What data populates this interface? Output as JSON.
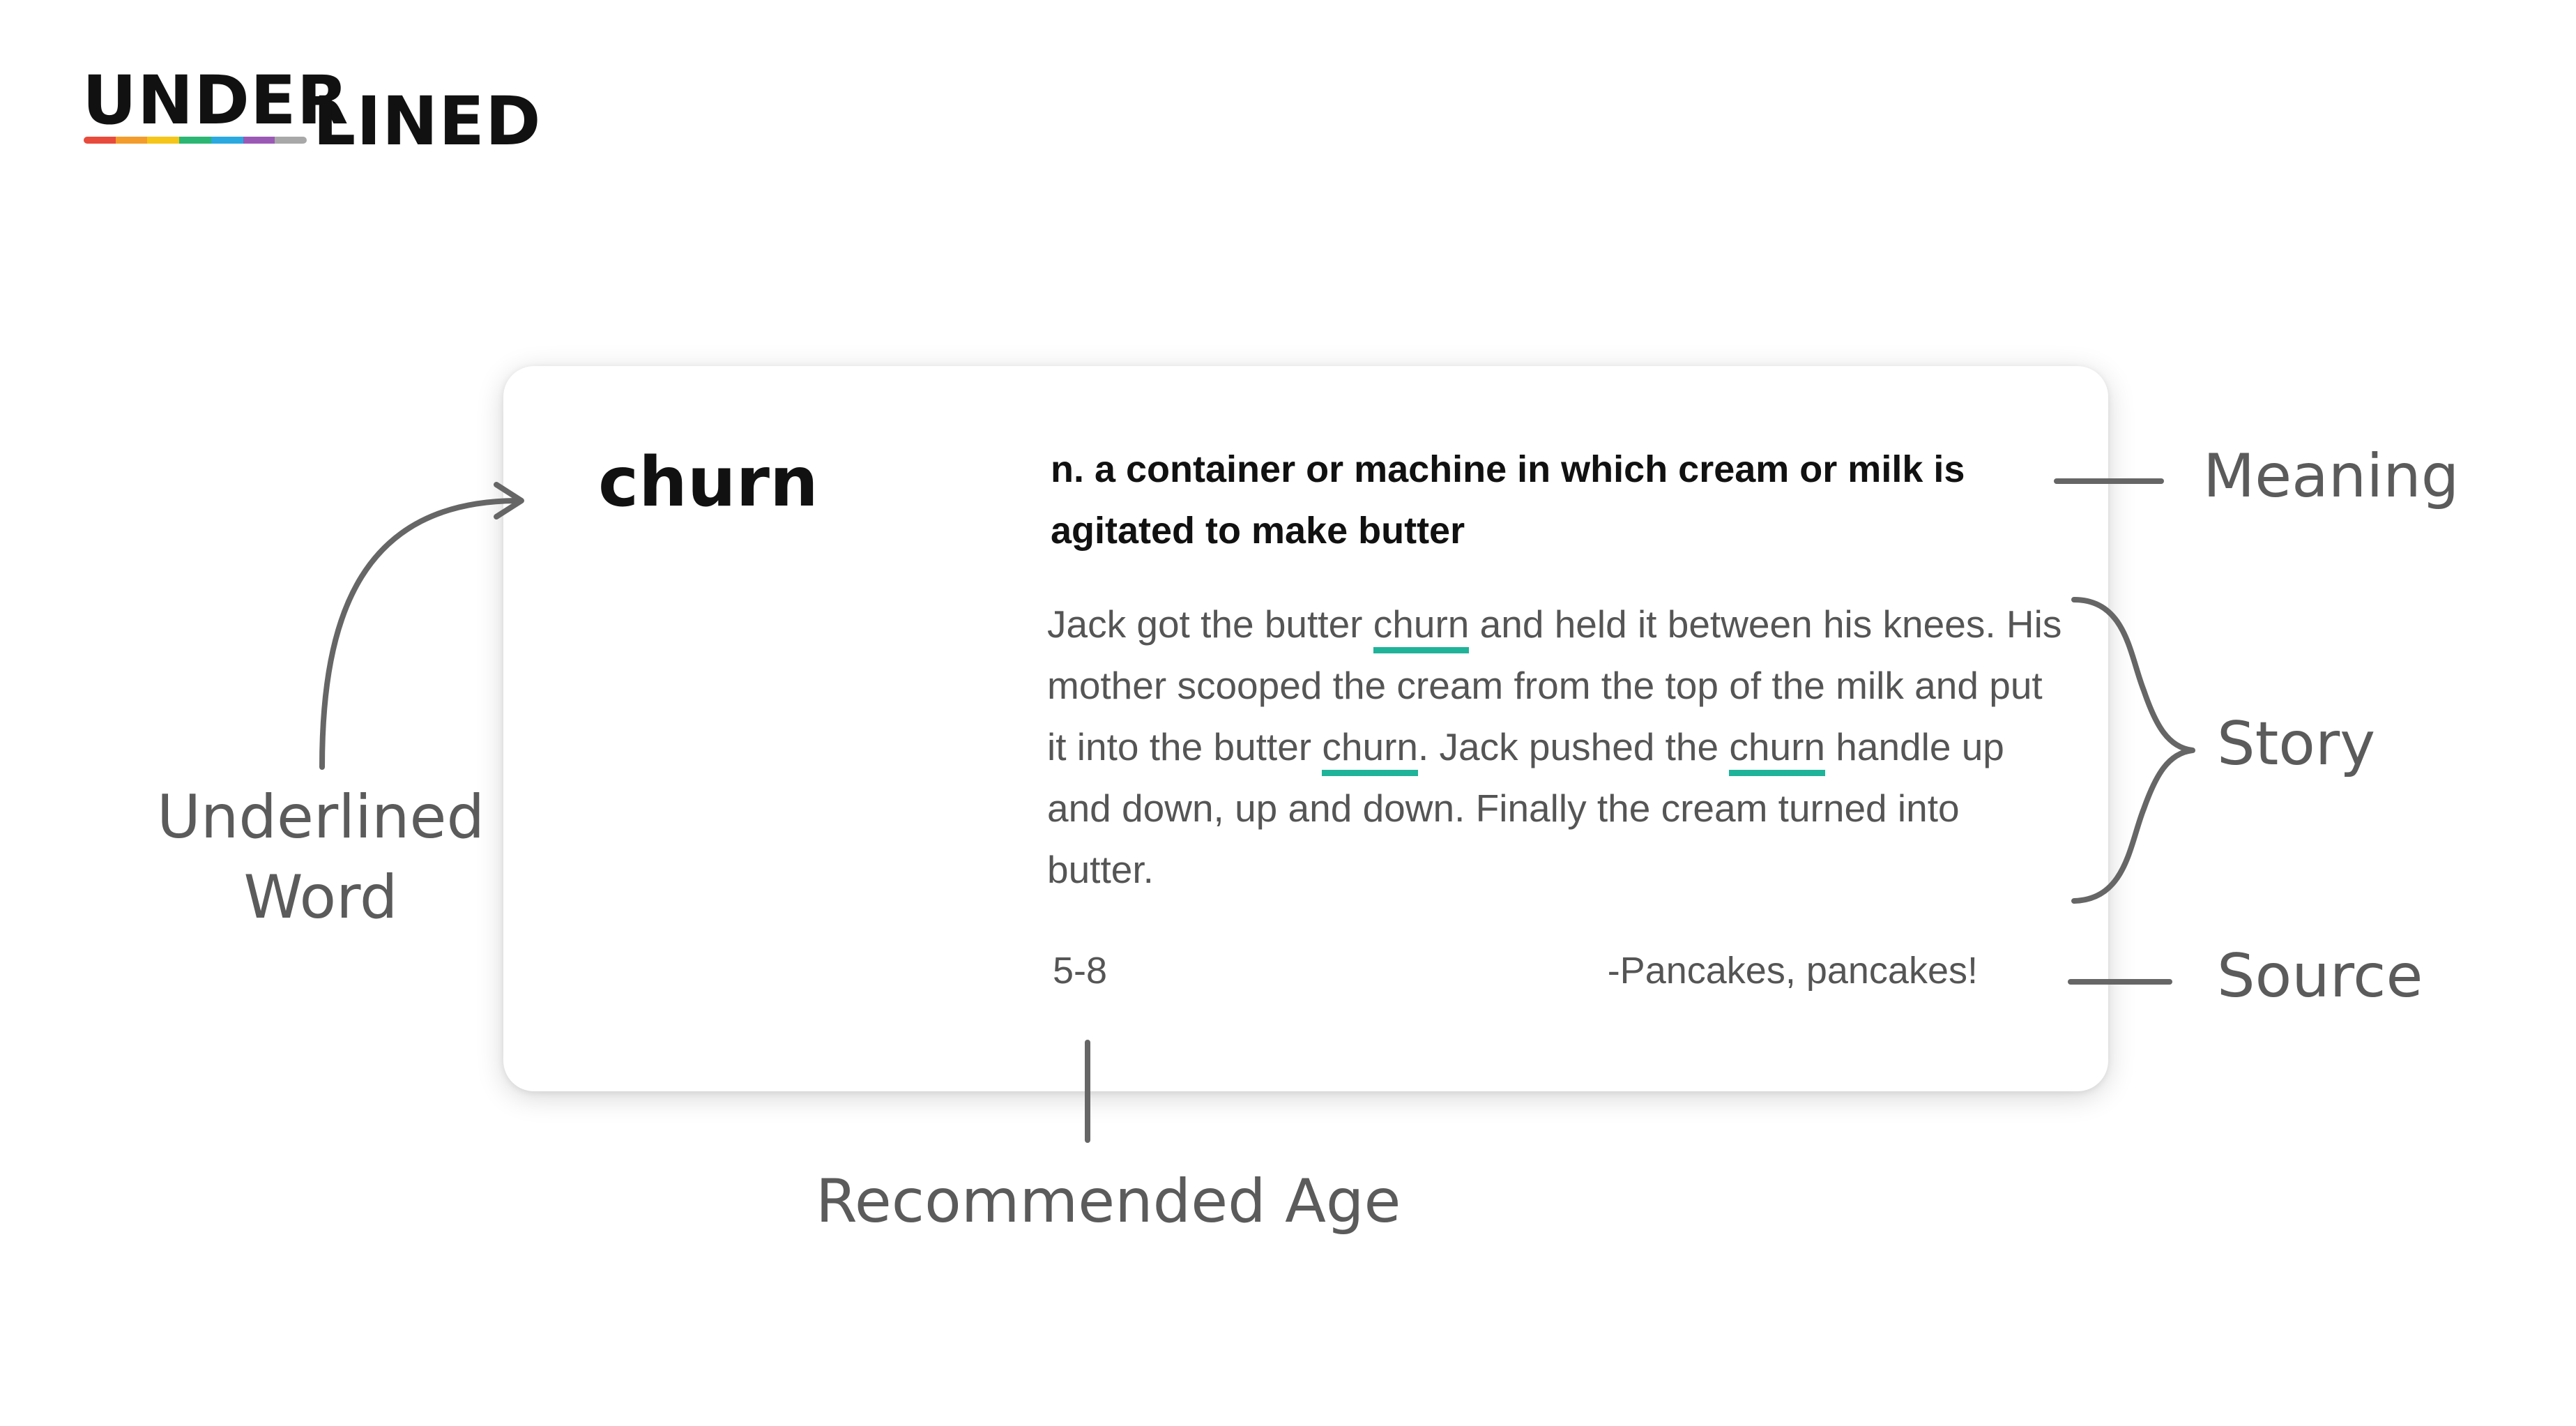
{
  "logo": {
    "part1": "UNDER",
    "part2": "LINED",
    "bar_colors": [
      "#e84a3c",
      "#f39c2b",
      "#f5c518",
      "#2bb673",
      "#29a9e0",
      "#9b59b6",
      "#a8a8a8"
    ]
  },
  "card": {
    "word": "churn",
    "meaning": "n. a container or machine in which cream or milk is agitated to make butter",
    "story": [
      {
        "text": "Jack got the butter ",
        "highlight": false
      },
      {
        "text": "churn",
        "highlight": true
      },
      {
        "text": " and held it between his knees. His mother scooped the cream from the top of the milk and put it into the butter ",
        "highlight": false
      },
      {
        "text": "churn",
        "highlight": true
      },
      {
        "text": ". Jack pushed the ",
        "highlight": false
      },
      {
        "text": "churn",
        "highlight": true
      },
      {
        "text": " handle up and down, up and down. Finally the cream turned into butter.",
        "highlight": false
      }
    ],
    "age": "5-8",
    "source": "-Pancakes, pancakes!"
  },
  "labels": {
    "underlined_word_line1": "Underlined",
    "underlined_word_line2": "Word",
    "meaning": "Meaning",
    "story": "Story",
    "source": "Source",
    "recommended_age": "Recommended Age"
  },
  "colors": {
    "highlight": "#1fb39a",
    "annotation": "#666666"
  }
}
